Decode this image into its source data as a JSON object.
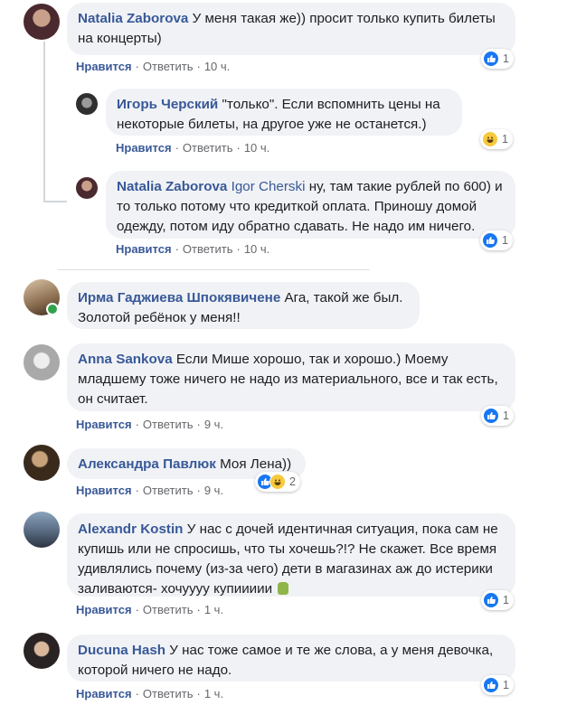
{
  "colors": {
    "link": "#385898",
    "bubble": "#f0f2f5",
    "meta": "#65676b",
    "like_blue": "#1877f2",
    "online": "#31a24c"
  },
  "action_labels": {
    "like": "Нравится",
    "reply": "Ответить",
    "sep": "·"
  },
  "comments": [
    {
      "author": "Natalia Zaborova",
      "text": "У меня такая же)) просит только купить билеты на концерты)",
      "time": "10 ч.",
      "reactions": [
        "like"
      ],
      "reaction_count": "1",
      "avatar_icon": "avatar-photo"
    },
    {
      "author": "Игорь Черский",
      "text": "\"только\". Если вспомнить цены на некоторые билеты, на другое уже не останется.)",
      "time": "10 ч.",
      "reactions": [
        "haha"
      ],
      "reaction_count": "1",
      "avatar_icon": "avatar-photo"
    },
    {
      "author": "Natalia Zaborova",
      "mention": "Igor Cherski",
      "text": "ну, там такие рублей по 600) и то только потому что кредиткой оплата. Приношу домой одежду, потом иду обратно сдавать. Не надо им ничего.",
      "time": "10 ч.",
      "reactions": [
        "like"
      ],
      "reaction_count": "1",
      "avatar_icon": "avatar-photo"
    },
    {
      "author": "Ирма Гаджиева Шпокявичене",
      "text": "Ага, такой же был. Золотой ребёнок у меня!!",
      "avatar_icon": "avatar-photo"
    },
    {
      "author": "Anna Sankova",
      "text": "Если Мише хорошо, так и хорошо.) Моему младшему тоже ничего не надо из материального, все и так есть, он считает.",
      "time": "9 ч.",
      "reactions": [
        "like"
      ],
      "reaction_count": "1",
      "avatar_icon": "avatar-photo"
    },
    {
      "author": "Александра Павлюк",
      "text": "Моя Лена))",
      "time": "9 ч.",
      "reactions": [
        "like",
        "haha"
      ],
      "reaction_count": "2",
      "avatar_icon": "avatar-photo"
    },
    {
      "author": "Alexandr Kostin",
      "text": "У нас с дочей идентичная ситуация, пока сам не купишь или не спросишь, что ты хочешь?!? Не скажет. Все время удивлялись почему (из-за чего) дети в магазинах аж до истерики заливаются- хочуууу купиииии",
      "time": "1 ч.",
      "reactions": [
        "like"
      ],
      "reaction_count": "1",
      "avatar_icon": "avatar-photo"
    },
    {
      "author": "Ducuna Hash",
      "text": "У нас тоже самое и те же слова, а у меня девочка, которой ничего не надо.",
      "time": "1 ч.",
      "reactions": [
        "like"
      ],
      "reaction_count": "1",
      "avatar_icon": "avatar-photo"
    }
  ]
}
